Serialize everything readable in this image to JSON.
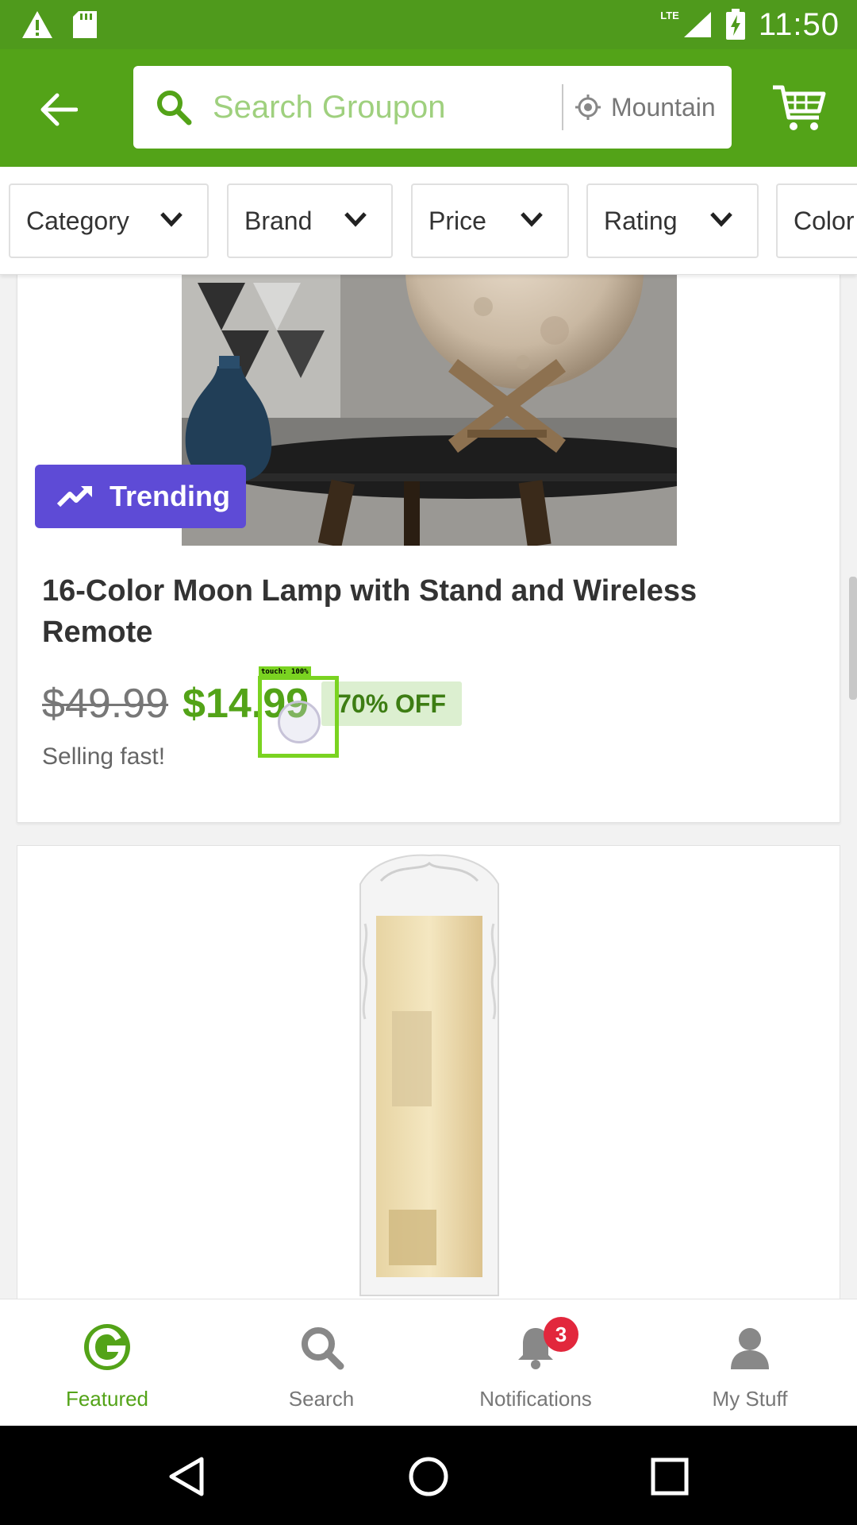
{
  "status_bar": {
    "time": "11:50",
    "network": "LTE",
    "icons": [
      "warning-icon",
      "sd-card-icon",
      "signal-icon",
      "battery-charging-icon"
    ]
  },
  "app_bar": {
    "search_placeholder": "Search Groupon",
    "location": "Mountain",
    "icons": [
      "back-arrow-icon",
      "search-icon",
      "location-icon",
      "cart-icon"
    ]
  },
  "filters": [
    {
      "label": "Category"
    },
    {
      "label": "Brand"
    },
    {
      "label": "Price"
    },
    {
      "label": "Rating"
    },
    {
      "label": "Color"
    }
  ],
  "product1": {
    "badge": "Trending",
    "title": "16-Color Moon Lamp with Stand and Wireless Remote",
    "original_price": "$49.99",
    "price": "$14.99",
    "discount": "70% OFF",
    "urgency": "Selling fast!"
  },
  "touch_overlay": {
    "label": "touch: 100%"
  },
  "bottom_nav": {
    "items": [
      {
        "label": "Featured",
        "icon": "groupon-g-icon",
        "active": true
      },
      {
        "label": "Search",
        "icon": "search-icon",
        "active": false
      },
      {
        "label": "Notifications",
        "icon": "bell-icon",
        "active": false,
        "badge": "3"
      },
      {
        "label": "My Stuff",
        "icon": "person-icon",
        "active": false
      }
    ]
  },
  "colors": {
    "brand_green": "#53a318",
    "status_green": "#4f9a1c",
    "trending_purple": "#5e4bd6",
    "badge_red": "#e2273c"
  }
}
